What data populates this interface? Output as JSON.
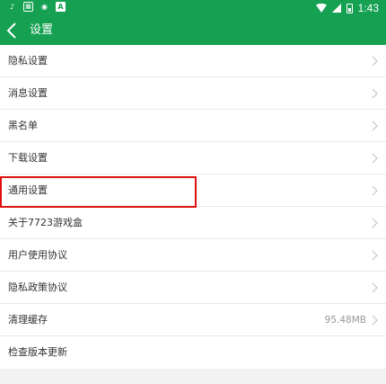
{
  "status_bar": {
    "left_icons": [
      "tiktok-icon",
      "app-icon",
      "sim-icon",
      "notification-icon"
    ],
    "time": "1:43",
    "battery_label": "1",
    "battery_level": 0.6
  },
  "header": {
    "title": "设置"
  },
  "settings": {
    "items": [
      {
        "label": "隐私设置"
      },
      {
        "label": "消息设置"
      },
      {
        "label": "黑名单"
      },
      {
        "label": "下载设置"
      },
      {
        "label": "通用设置"
      },
      {
        "label": "关于7723游戏盒"
      },
      {
        "label": "用户使用协议"
      },
      {
        "label": "隐私政策协议"
      },
      {
        "label": "清理缓存",
        "value": "95.48MB"
      },
      {
        "label": "检查版本更新"
      }
    ]
  },
  "colors": {
    "primary": "#15a052",
    "highlight": "#e01010"
  }
}
